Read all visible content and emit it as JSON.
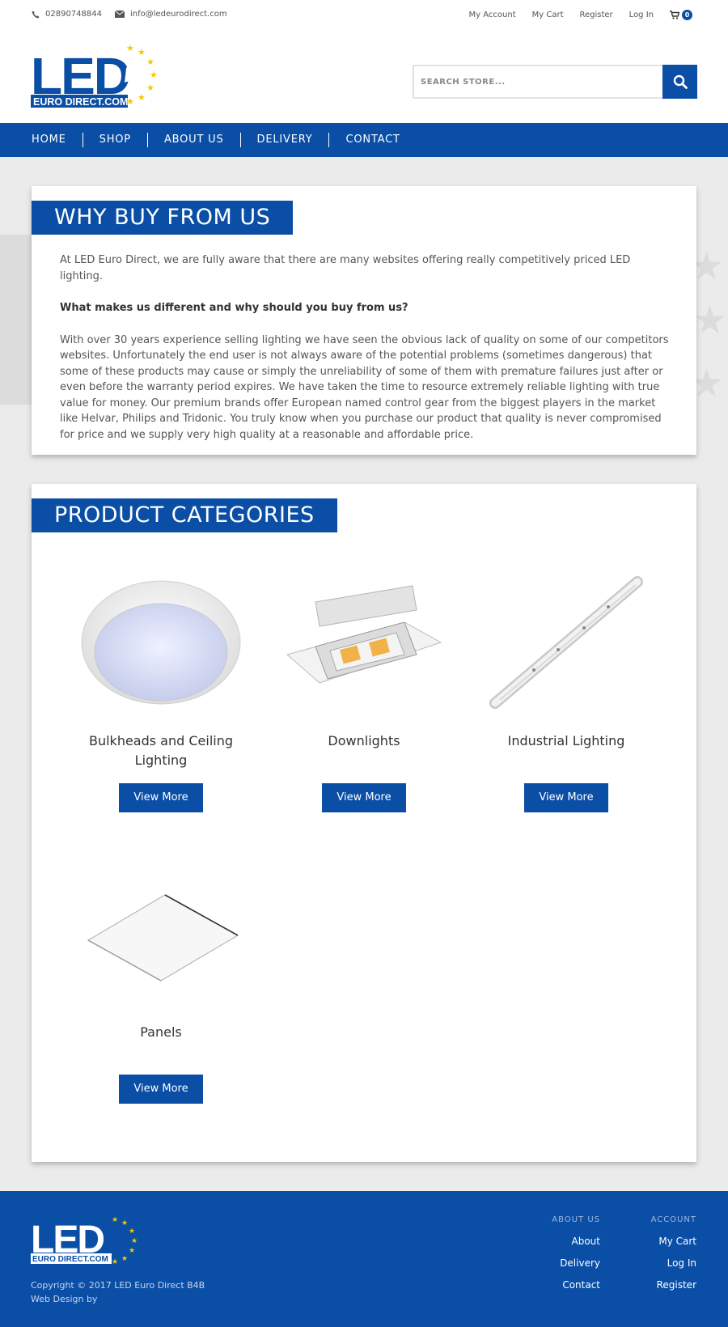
{
  "topbar": {
    "phone": "02890748844",
    "email": "info@ledeurodirect.com",
    "links": [
      "My Account",
      "My Cart",
      "Register",
      "Log In"
    ],
    "cart_count": "0"
  },
  "logo": {
    "main": "LED",
    "sub": "EURO DIRECT.COM"
  },
  "search": {
    "placeholder": "SEARCH STORE..."
  },
  "nav": [
    "HOME",
    "SHOP",
    "ABOUT US",
    "DELIVERY",
    "CONTACT"
  ],
  "why": {
    "title": "WHY BUY FROM US",
    "intro": "At LED Euro Direct, we are fully aware that there are many websites offering really competitively priced LED lighting.",
    "question": "What makes us different and why should you buy from us?",
    "body": "With over 30 years experience selling lighting we have seen the obvious lack of quality on some of our competitors websites. Unfortunately the end user is not always aware of the potential problems (sometimes dangerous) that some of these products may cause or simply the unreliability of some of them with premature failures just after or even before the warranty period expires. We have taken the time to resource extremely reliable lighting with true value for money. Our premium brands offer European named control gear from the biggest players in the market like Helvar, Philips and Tridonic. You truly know when you purchase our product that quality is never compromised for price and we supply very high quality at a reasonable and affordable price."
  },
  "categories": {
    "title": "PRODUCT CATEGORIES",
    "items": [
      {
        "name": "Bulkheads and Ceiling Lighting",
        "button": "View More"
      },
      {
        "name": "Downlights",
        "button": "View More"
      },
      {
        "name": "Industrial Lighting",
        "button": "View More"
      },
      {
        "name": "Panels",
        "button": "View More"
      }
    ]
  },
  "footer": {
    "copyright": "Copyright © 2017 LED Euro Direct B4B",
    "webdesign": "Web Design by",
    "about": {
      "heading": "ABOUT US",
      "links": [
        "About",
        "Delivery",
        "Contact"
      ]
    },
    "account": {
      "heading": "ACCOUNT",
      "links": [
        "My Cart",
        "Log In",
        "Register"
      ]
    }
  },
  "colors": {
    "brand_blue": "#0a4ea6",
    "star_yellow": "#f6c800"
  }
}
